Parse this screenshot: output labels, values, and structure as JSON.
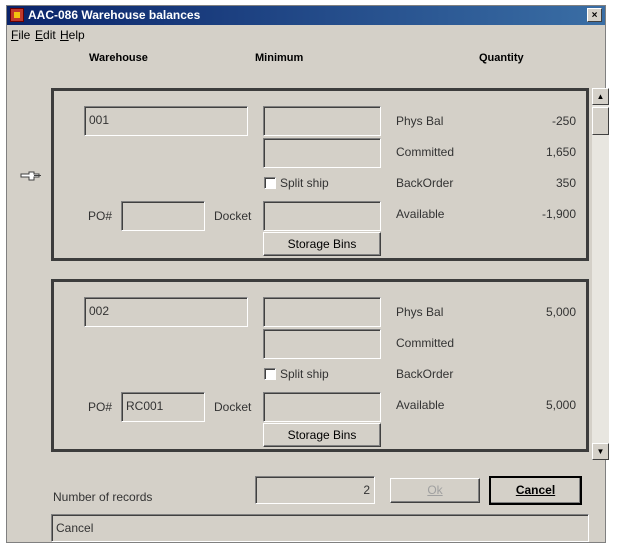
{
  "window": {
    "title": "AAC-086 Warehouse balances",
    "close_glyph": "×"
  },
  "menu": [
    {
      "label": "File",
      "accel": "F",
      "rest": "ile"
    },
    {
      "label": "Edit",
      "accel": "E",
      "rest": "dit"
    },
    {
      "label": "Help",
      "accel": "H",
      "rest": "elp"
    }
  ],
  "columns": {
    "warehouse": "Warehouse",
    "minimum": "Minimum",
    "quantity": "Quantity"
  },
  "labels": {
    "po": "PO#",
    "docket": "Docket",
    "split_ship": "Split ship",
    "storage_bins": "Storage Bins",
    "phys_bal": "Phys Bal",
    "committed": "Committed",
    "backorder": "BackOrder",
    "available": "Available"
  },
  "records": [
    {
      "warehouse": "001",
      "min1": "",
      "min2": "",
      "split_ship": false,
      "po": "",
      "docket": "",
      "phys_bal": "-250",
      "committed": "1,650",
      "backorder": "350",
      "available": "-1,900"
    },
    {
      "warehouse": "002",
      "min1": "",
      "min2": "",
      "split_ship": false,
      "po": "RC001",
      "docket": "",
      "phys_bal": "5,000",
      "committed": "",
      "backorder": "",
      "available": "5,000"
    }
  ],
  "footer": {
    "records_label": "Number of records",
    "records_count": "2",
    "ok_label": "Ok",
    "cancel_label": "Cancel",
    "status": "Cancel"
  },
  "colors": {
    "title_start": "#0a246a",
    "title_end": "#3a6ea5",
    "face": "#d4d0c8"
  }
}
